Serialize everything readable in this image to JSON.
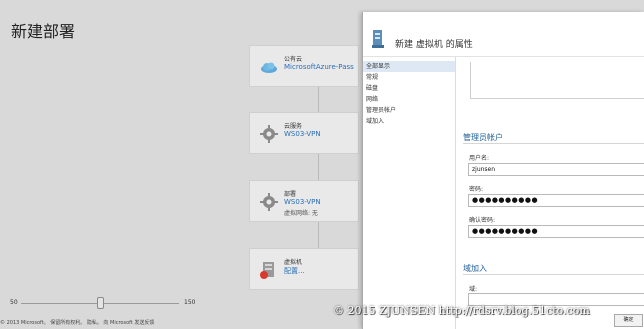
{
  "page": {
    "title": "新建部署"
  },
  "cards": [
    {
      "label": "公有云",
      "value": "MicrosoftAzure-Pass",
      "sub": "",
      "icon": "cloud-icon"
    },
    {
      "label": "云服务",
      "value": "WS03-VPN",
      "sub": "",
      "icon": "gear-icon"
    },
    {
      "label": "部署",
      "value": "WS03-VPN",
      "sub": "虚拟网络: 无",
      "icon": "gear-icon"
    },
    {
      "label": "虚拟机",
      "value": "配置...",
      "sub": "",
      "icon": "vm-icon"
    }
  ],
  "slider": {
    "min": "50",
    "max": "150",
    "value_fraction": 0.5
  },
  "footer": {
    "text": "© 2013 Microsoft。 保留所有权利。   隐私。   向 Microsoft 发送反馈"
  },
  "dialog": {
    "title": "新建 虚拟机 的属性",
    "nav": [
      "全部显示",
      "常规",
      "磁盘",
      "网络",
      "管理员帐户",
      "域加入"
    ],
    "selected_nav": "全部显示",
    "admin_section": "管理员帐户",
    "username_label": "用户名:",
    "username_value": "zjunsen",
    "password_label": "密码:",
    "password_value": "●●●●●●●●●●",
    "confirm_label": "确认密码:",
    "confirm_value": "●●●●●●●●●●",
    "domain_section": "域加入",
    "domain_label": "域:",
    "ok_label": "确定"
  },
  "watermark": "© 2015 ZJUNSEN http://rdsrv.blog.51cto.com",
  "colors": {
    "accent": "#2a6fb8",
    "section_title": "#1f5f9c",
    "nav_selected": "#dde8f4"
  }
}
